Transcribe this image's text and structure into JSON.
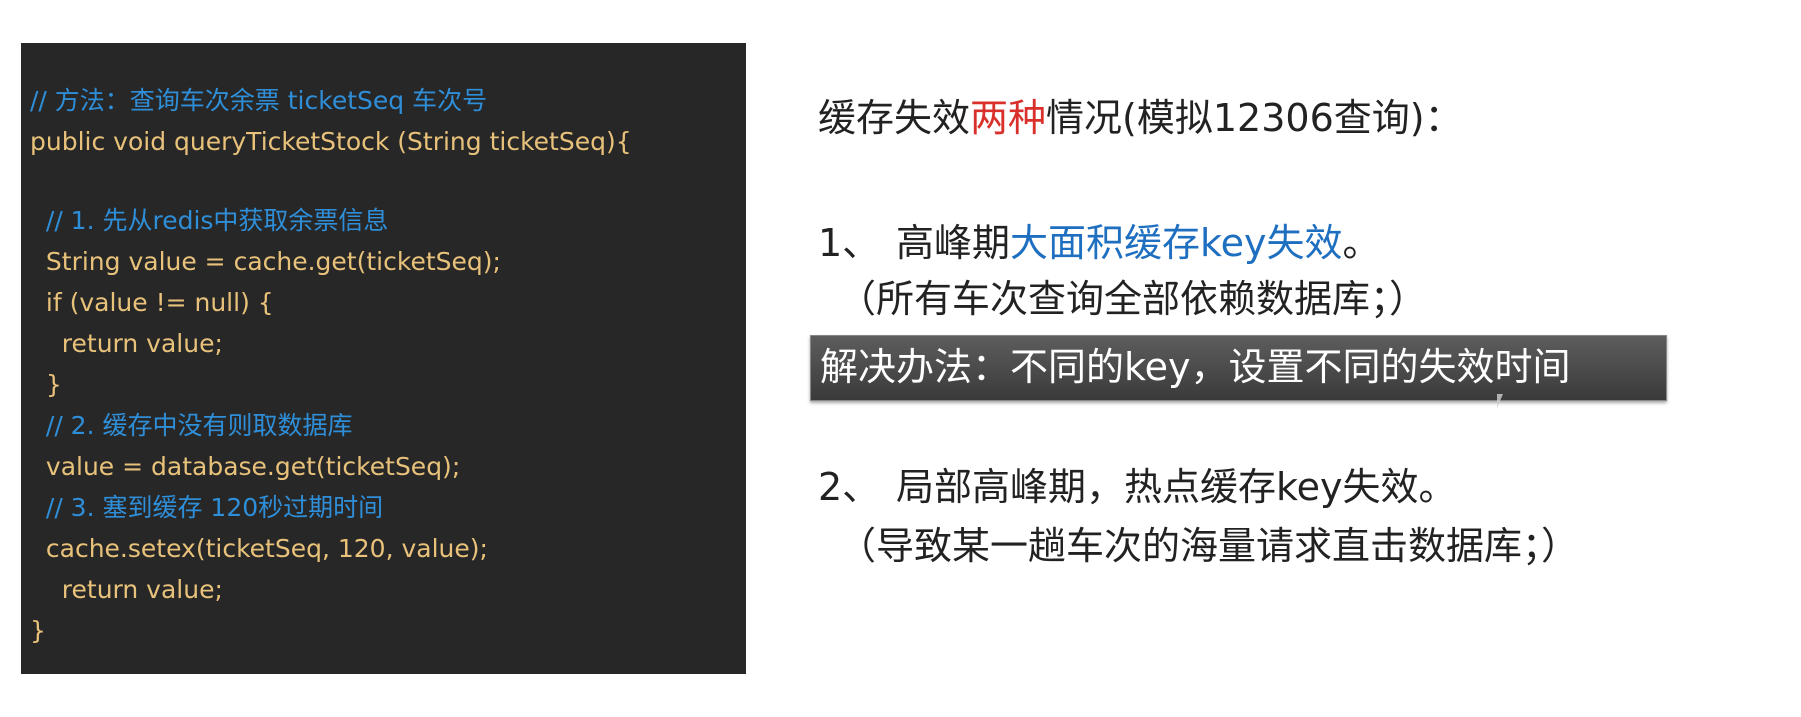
{
  "code": {
    "lines": [
      "// 方法：查询车次余票 ticketSeq 车次号",
      "public void queryTicketStock (String ticketSeq){",
      "",
      "  // 1. 先从redis中获取余票信息",
      "  String value = cache.get(ticketSeq);",
      "  if (value != null) {",
      "    return value;",
      "  }",
      "  // 2. 缓存中没有则取数据库",
      "  value = database.get(ticketSeq);",
      "  // 3. 塞到缓存 120秒过期时间",
      "  cache.setex(ticketSeq, 120, value);",
      "    return value;",
      "}"
    ]
  },
  "slide": {
    "title_pre": "缓存失效",
    "title_highlight": "两种",
    "title_post": "情况(模拟12306查询)：",
    "item1": {
      "number": "1、",
      "text_pre": "高峰期",
      "text_highlight": "大面积缓存key失效",
      "text_post": "。",
      "note": "（所有车次查询全部依赖数据库；）"
    },
    "solution": "解决办法：不同的key，设置不同的失效时间",
    "item2": {
      "number": "2、",
      "text": "局部高峰期，热点缓存key失效。",
      "note": "（导致某一趟车次的海量请求直击数据库；）"
    }
  },
  "colors": {
    "code_bg": "#272727",
    "code_text": "#e8c27a",
    "code_comment": "#2f8ed8",
    "title_highlight": "#d9302c",
    "item_highlight": "#1f6fc0",
    "solution_bg": "#4a4a4a"
  }
}
